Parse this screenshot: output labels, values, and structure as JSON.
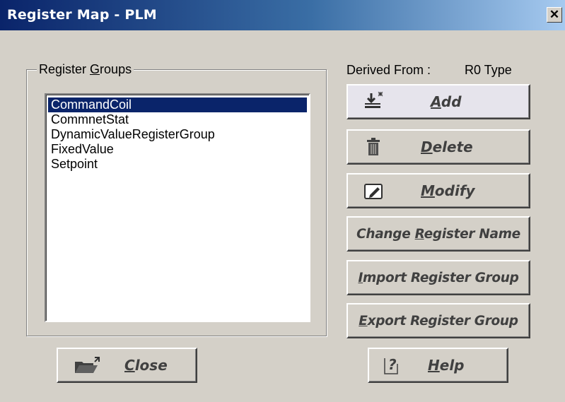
{
  "window": {
    "title": "Register Map - PLM",
    "close_glyph": "✕"
  },
  "groupbox": {
    "label_pre": "Register ",
    "label_mnemonic": "G",
    "label_post": "roups"
  },
  "list": {
    "items": [
      "CommandCoil",
      "CommnetStat",
      "DynamicValueRegisterGroup",
      "FixedValue",
      "Setpoint"
    ],
    "selected_index": 0
  },
  "derived": {
    "label": "Derived From :",
    "value": "R0 Type"
  },
  "buttons": {
    "add": {
      "mnemonic": "A",
      "rest": "dd",
      "icon": "add-register-icon"
    },
    "delete": {
      "mnemonic": "D",
      "rest": "elete",
      "icon": "trash-icon"
    },
    "modify": {
      "mnemonic": "M",
      "rest": "odify",
      "icon": "edit-icon"
    },
    "change_name": {
      "pre": "Change ",
      "mnemonic": "R",
      "rest": "egister Name"
    },
    "import": {
      "mnemonic": "I",
      "rest": "mport Register Group"
    },
    "export": {
      "mnemonic": "E",
      "rest": "xport Register Group"
    },
    "close": {
      "mnemonic": "C",
      "rest": "lose",
      "icon": "folder-icon"
    },
    "help": {
      "mnemonic": "H",
      "rest": "elp",
      "icon": "help-icon"
    }
  },
  "colors": {
    "titlebar_start": "#0a246a",
    "titlebar_end": "#a6caf0",
    "selection": "#0a246a",
    "dialog_bg": "#d4d0c8"
  }
}
